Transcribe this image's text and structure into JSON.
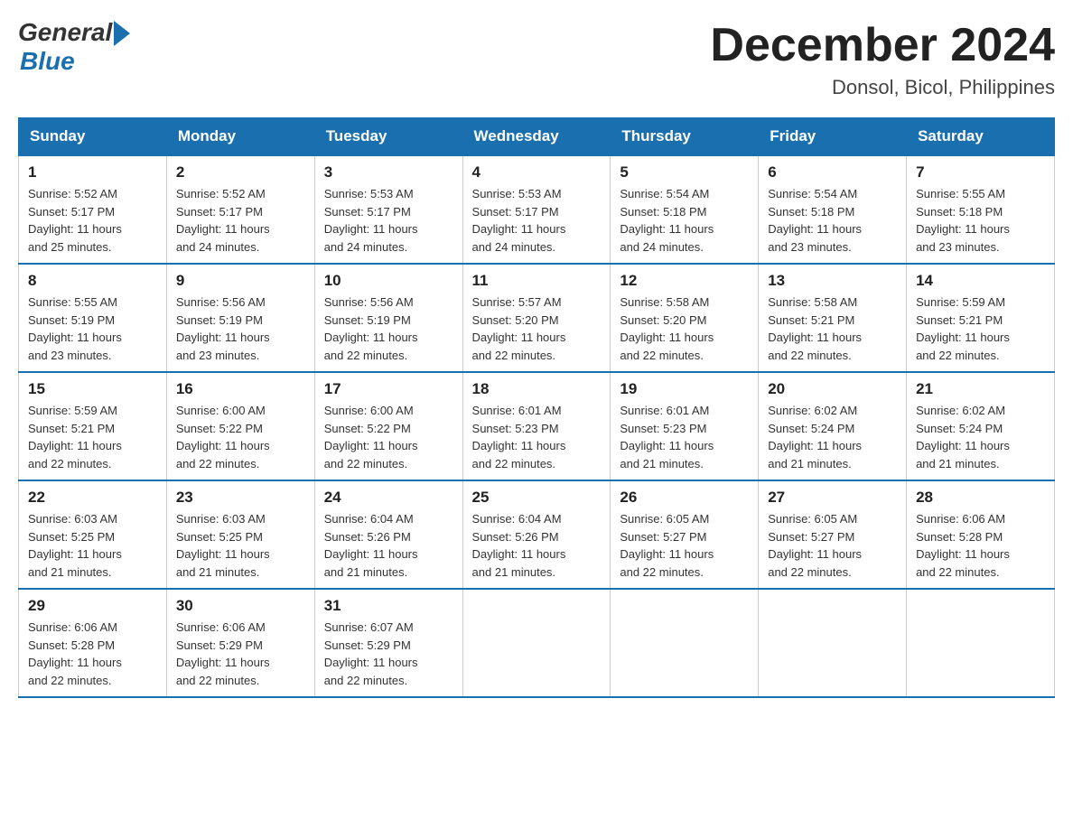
{
  "logo": {
    "general": "General",
    "blue": "Blue"
  },
  "title": {
    "month_year": "December 2024",
    "location": "Donsol, Bicol, Philippines"
  },
  "days_of_week": [
    "Sunday",
    "Monday",
    "Tuesday",
    "Wednesday",
    "Thursday",
    "Friday",
    "Saturday"
  ],
  "weeks": [
    [
      {
        "day": "1",
        "sunrise": "5:52 AM",
        "sunset": "5:17 PM",
        "daylight": "11 hours and 25 minutes."
      },
      {
        "day": "2",
        "sunrise": "5:52 AM",
        "sunset": "5:17 PM",
        "daylight": "11 hours and 24 minutes."
      },
      {
        "day": "3",
        "sunrise": "5:53 AM",
        "sunset": "5:17 PM",
        "daylight": "11 hours and 24 minutes."
      },
      {
        "day": "4",
        "sunrise": "5:53 AM",
        "sunset": "5:17 PM",
        "daylight": "11 hours and 24 minutes."
      },
      {
        "day": "5",
        "sunrise": "5:54 AM",
        "sunset": "5:18 PM",
        "daylight": "11 hours and 24 minutes."
      },
      {
        "day": "6",
        "sunrise": "5:54 AM",
        "sunset": "5:18 PM",
        "daylight": "11 hours and 23 minutes."
      },
      {
        "day": "7",
        "sunrise": "5:55 AM",
        "sunset": "5:18 PM",
        "daylight": "11 hours and 23 minutes."
      }
    ],
    [
      {
        "day": "8",
        "sunrise": "5:55 AM",
        "sunset": "5:19 PM",
        "daylight": "11 hours and 23 minutes."
      },
      {
        "day": "9",
        "sunrise": "5:56 AM",
        "sunset": "5:19 PM",
        "daylight": "11 hours and 23 minutes."
      },
      {
        "day": "10",
        "sunrise": "5:56 AM",
        "sunset": "5:19 PM",
        "daylight": "11 hours and 22 minutes."
      },
      {
        "day": "11",
        "sunrise": "5:57 AM",
        "sunset": "5:20 PM",
        "daylight": "11 hours and 22 minutes."
      },
      {
        "day": "12",
        "sunrise": "5:58 AM",
        "sunset": "5:20 PM",
        "daylight": "11 hours and 22 minutes."
      },
      {
        "day": "13",
        "sunrise": "5:58 AM",
        "sunset": "5:21 PM",
        "daylight": "11 hours and 22 minutes."
      },
      {
        "day": "14",
        "sunrise": "5:59 AM",
        "sunset": "5:21 PM",
        "daylight": "11 hours and 22 minutes."
      }
    ],
    [
      {
        "day": "15",
        "sunrise": "5:59 AM",
        "sunset": "5:21 PM",
        "daylight": "11 hours and 22 minutes."
      },
      {
        "day": "16",
        "sunrise": "6:00 AM",
        "sunset": "5:22 PM",
        "daylight": "11 hours and 22 minutes."
      },
      {
        "day": "17",
        "sunrise": "6:00 AM",
        "sunset": "5:22 PM",
        "daylight": "11 hours and 22 minutes."
      },
      {
        "day": "18",
        "sunrise": "6:01 AM",
        "sunset": "5:23 PM",
        "daylight": "11 hours and 22 minutes."
      },
      {
        "day": "19",
        "sunrise": "6:01 AM",
        "sunset": "5:23 PM",
        "daylight": "11 hours and 21 minutes."
      },
      {
        "day": "20",
        "sunrise": "6:02 AM",
        "sunset": "5:24 PM",
        "daylight": "11 hours and 21 minutes."
      },
      {
        "day": "21",
        "sunrise": "6:02 AM",
        "sunset": "5:24 PM",
        "daylight": "11 hours and 21 minutes."
      }
    ],
    [
      {
        "day": "22",
        "sunrise": "6:03 AM",
        "sunset": "5:25 PM",
        "daylight": "11 hours and 21 minutes."
      },
      {
        "day": "23",
        "sunrise": "6:03 AM",
        "sunset": "5:25 PM",
        "daylight": "11 hours and 21 minutes."
      },
      {
        "day": "24",
        "sunrise": "6:04 AM",
        "sunset": "5:26 PM",
        "daylight": "11 hours and 21 minutes."
      },
      {
        "day": "25",
        "sunrise": "6:04 AM",
        "sunset": "5:26 PM",
        "daylight": "11 hours and 21 minutes."
      },
      {
        "day": "26",
        "sunrise": "6:05 AM",
        "sunset": "5:27 PM",
        "daylight": "11 hours and 22 minutes."
      },
      {
        "day": "27",
        "sunrise": "6:05 AM",
        "sunset": "5:27 PM",
        "daylight": "11 hours and 22 minutes."
      },
      {
        "day": "28",
        "sunrise": "6:06 AM",
        "sunset": "5:28 PM",
        "daylight": "11 hours and 22 minutes."
      }
    ],
    [
      {
        "day": "29",
        "sunrise": "6:06 AM",
        "sunset": "5:28 PM",
        "daylight": "11 hours and 22 minutes."
      },
      {
        "day": "30",
        "sunrise": "6:06 AM",
        "sunset": "5:29 PM",
        "daylight": "11 hours and 22 minutes."
      },
      {
        "day": "31",
        "sunrise": "6:07 AM",
        "sunset": "5:29 PM",
        "daylight": "11 hours and 22 minutes."
      },
      null,
      null,
      null,
      null
    ]
  ],
  "labels": {
    "sunrise": "Sunrise:",
    "sunset": "Sunset:",
    "daylight": "Daylight:"
  }
}
